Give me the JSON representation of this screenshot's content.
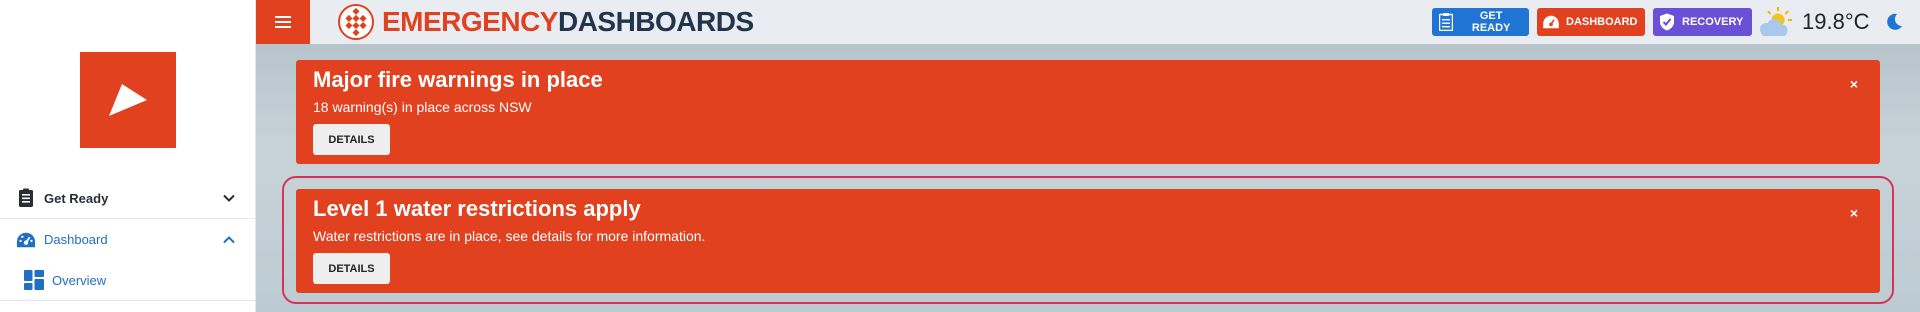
{
  "sidebar": {
    "items": [
      {
        "label": "Get Ready",
        "icon": "clipboard-icon"
      },
      {
        "label": "Dashboard",
        "icon": "gauge-icon"
      },
      {
        "label": "Overview",
        "icon": "grid-icon"
      }
    ]
  },
  "header": {
    "brand_part1": "EMERGENCY",
    "brand_part2": "DASHBOARDS",
    "buttons": {
      "get_ready": "GET READY",
      "dashboard": "DASHBOARD",
      "recovery": "RECOVERY"
    },
    "temperature": "19.8°C"
  },
  "alerts": [
    {
      "title": "Major fire warnings in place",
      "description": "18 warning(s) in place across NSW",
      "button": "DETAILS",
      "close": "×"
    },
    {
      "title": "Level 1 water restrictions apply",
      "description": "Water restrictions are in place, see details for more information.",
      "button": "DETAILS",
      "close": "×"
    }
  ],
  "colors": {
    "brand_red": "#e2411f",
    "brand_navy": "#23344d",
    "get_ready_blue": "#1f74d4",
    "recovery_purple": "#6a4fd7",
    "link_blue": "#1f6fc3",
    "focus_ring": "#d7335a"
  }
}
